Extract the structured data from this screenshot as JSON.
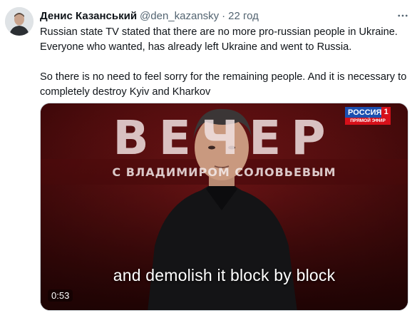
{
  "tweet": {
    "author_name": "Денис Казанський",
    "handle": "@den_kazansky",
    "separator": "·",
    "time": "22 год",
    "paragraphs": [
      "Russian state TV stated that there are no more pro-russian people in Ukraine. Everyone who wanted, has already left Ukraine and went to Russia.",
      "So there is no need to feel sorry for the remaining people. And it is necessary to completely destroy Kyiv and Kharkov"
    ]
  },
  "video": {
    "caption": "and demolish it block by block",
    "duration": "0:53",
    "channel_logo_top": "РОССИЯ",
    "channel_logo_number": "1",
    "channel_logo_bottom": "ПРЯМОЙ ЭФИР",
    "show_title": "ВЕЧЕР",
    "show_subtitle": "С ВЛАДИМИРОМ СОЛОВЬЕВЫМ"
  },
  "icons": {
    "more": "more-horizontal-icon"
  },
  "colors": {
    "text_primary": "#0f1419",
    "text_secondary": "#536471",
    "video_background": "#4a0a0b"
  }
}
